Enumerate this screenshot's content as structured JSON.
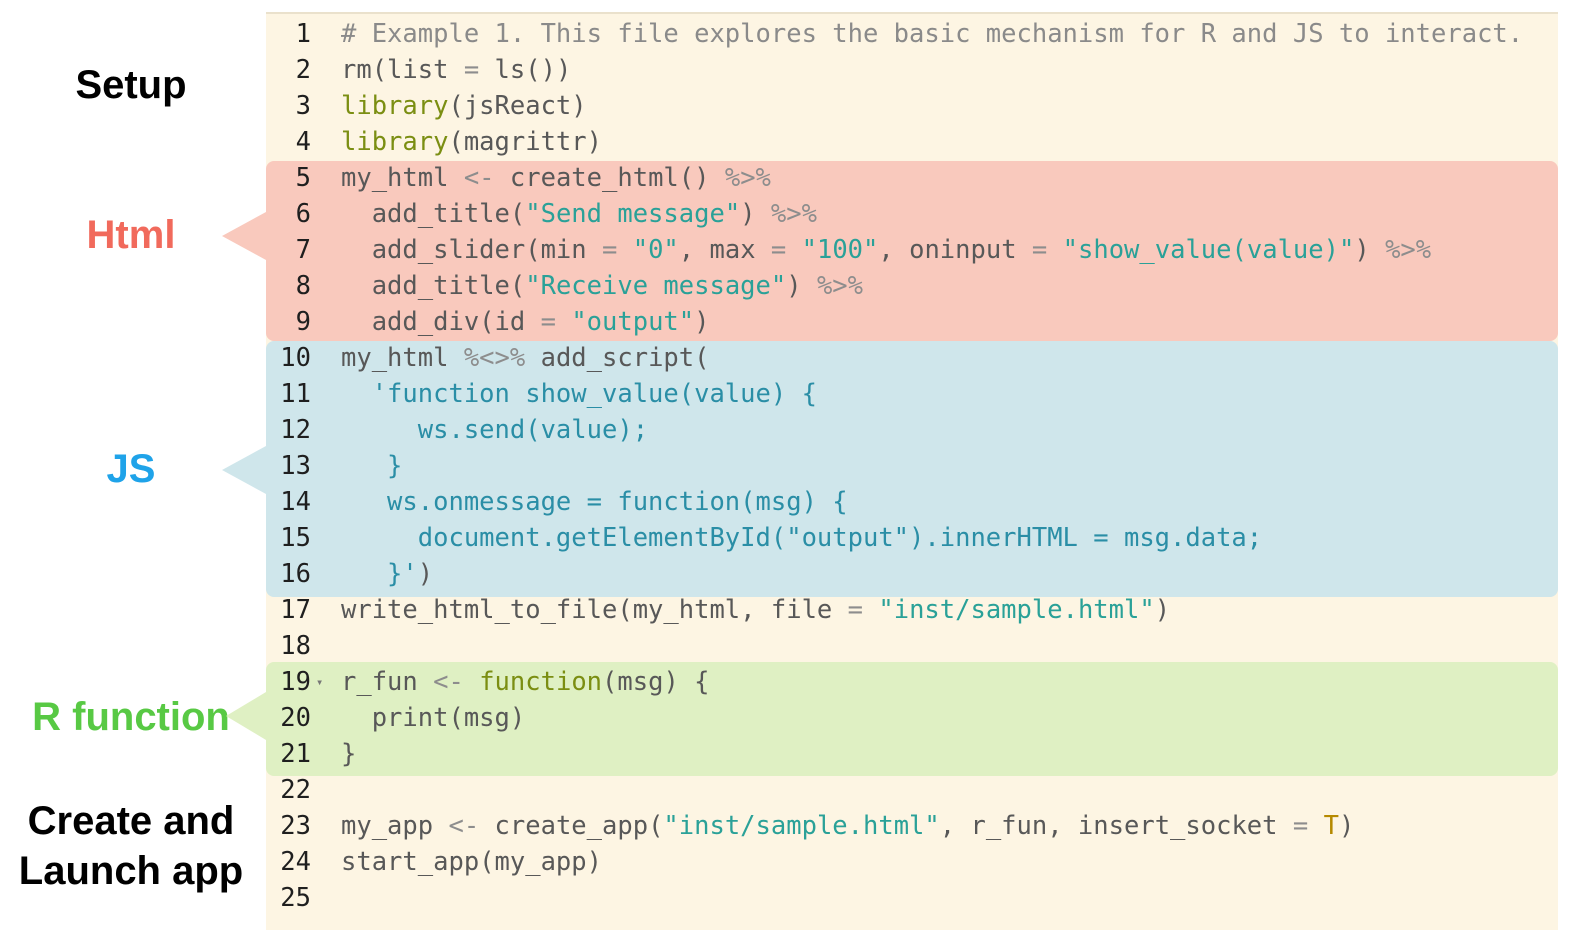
{
  "sections": {
    "setup": "Setup",
    "html": "Html",
    "js": "JS",
    "r_function": "R function",
    "launch_line1": "Create and",
    "launch_line2": "Launch app"
  },
  "colors": {
    "html_block": "#f9c9bd",
    "js_block": "#cfe6eb",
    "r_function_block": "#dff0c3",
    "editor_bg": "#fdf5e3"
  },
  "fold_icon": "triangle-down-icon",
  "code_lines": [
    {
      "n": "1",
      "tokens": [
        [
          "c-comment",
          "# Example 1. This file explores the basic mechanism for R and JS to interact."
        ]
      ]
    },
    {
      "n": "2",
      "tokens": [
        [
          "c-plain",
          "rm(list "
        ],
        [
          "c-op",
          "="
        ],
        [
          "c-plain",
          " ls())"
        ]
      ]
    },
    {
      "n": "3",
      "tokens": [
        [
          "c-fn",
          "library"
        ],
        [
          "c-plain",
          "(jsReact)"
        ]
      ]
    },
    {
      "n": "4",
      "tokens": [
        [
          "c-fn",
          "library"
        ],
        [
          "c-plain",
          "(magrittr)"
        ]
      ]
    },
    {
      "n": "5",
      "tokens": [
        [
          "c-plain",
          "my_html "
        ],
        [
          "c-op",
          "<-"
        ],
        [
          "c-plain",
          " create_html() "
        ],
        [
          "c-op",
          "%>%"
        ]
      ]
    },
    {
      "n": "6",
      "tokens": [
        [
          "c-plain",
          "  add_title("
        ],
        [
          "c-str",
          "\"Send message\""
        ],
        [
          "c-plain",
          ") "
        ],
        [
          "c-op",
          "%>%"
        ]
      ]
    },
    {
      "n": "7",
      "tokens": [
        [
          "c-plain",
          "  add_slider(min "
        ],
        [
          "c-op",
          "="
        ],
        [
          "c-plain",
          " "
        ],
        [
          "c-str",
          "\"0\""
        ],
        [
          "c-plain",
          ", max "
        ],
        [
          "c-op",
          "="
        ],
        [
          "c-plain",
          " "
        ],
        [
          "c-str",
          "\"100\""
        ],
        [
          "c-plain",
          ", oninput "
        ],
        [
          "c-op",
          "="
        ],
        [
          "c-plain",
          " "
        ],
        [
          "c-str",
          "\"show_value(value)\""
        ],
        [
          "c-plain",
          ") "
        ],
        [
          "c-op",
          "%>%"
        ]
      ]
    },
    {
      "n": "8",
      "tokens": [
        [
          "c-plain",
          "  add_title("
        ],
        [
          "c-str",
          "\"Receive message\""
        ],
        [
          "c-plain",
          ") "
        ],
        [
          "c-op",
          "%>%"
        ]
      ]
    },
    {
      "n": "9",
      "tokens": [
        [
          "c-plain",
          "  add_div(id "
        ],
        [
          "c-op",
          "="
        ],
        [
          "c-plain",
          " "
        ],
        [
          "c-str",
          "\"output\""
        ],
        [
          "c-plain",
          ")"
        ]
      ]
    },
    {
      "n": "10",
      "tokens": [
        [
          "c-plain",
          "my_html "
        ],
        [
          "c-op",
          "%<>%"
        ],
        [
          "c-plain",
          " add_script("
        ]
      ]
    },
    {
      "n": "11",
      "tokens": [
        [
          "c-js",
          "  'function show_value(value) {"
        ]
      ]
    },
    {
      "n": "12",
      "tokens": [
        [
          "c-js",
          "     ws.send(value);"
        ]
      ]
    },
    {
      "n": "13",
      "tokens": [
        [
          "c-js",
          "   }"
        ]
      ]
    },
    {
      "n": "14",
      "tokens": [
        [
          "c-js",
          "   ws.onmessage = function(msg) {"
        ]
      ]
    },
    {
      "n": "15",
      "tokens": [
        [
          "c-js",
          "     document.getElementById(\"output\").innerHTML = msg.data;"
        ]
      ]
    },
    {
      "n": "16",
      "tokens": [
        [
          "c-js",
          "   }'"
        ],
        [
          "c-plain",
          ")"
        ]
      ]
    },
    {
      "n": "17",
      "tokens": [
        [
          "c-plain",
          "write_html_to_file(my_html, file "
        ],
        [
          "c-op",
          "="
        ],
        [
          "c-plain",
          " "
        ],
        [
          "c-str",
          "\"inst/sample.html\""
        ],
        [
          "c-plain",
          ")"
        ]
      ]
    },
    {
      "n": "18",
      "tokens": []
    },
    {
      "n": "19",
      "fold": true,
      "tokens": [
        [
          "c-plain",
          "r_fun "
        ],
        [
          "c-op",
          "<-"
        ],
        [
          "c-plain",
          " "
        ],
        [
          "c-fn",
          "function"
        ],
        [
          "c-plain",
          "(msg) {"
        ]
      ]
    },
    {
      "n": "20",
      "tokens": [
        [
          "c-plain",
          "  print(msg)"
        ]
      ]
    },
    {
      "n": "21",
      "tokens": [
        [
          "c-plain",
          "}"
        ]
      ]
    },
    {
      "n": "22",
      "tokens": []
    },
    {
      "n": "23",
      "tokens": [
        [
          "c-plain",
          "my_app "
        ],
        [
          "c-op",
          "<-"
        ],
        [
          "c-plain",
          " create_app("
        ],
        [
          "c-str",
          "\"inst/sample.html\""
        ],
        [
          "c-plain",
          ", r_fun, insert_socket "
        ],
        [
          "c-op",
          "="
        ],
        [
          "c-plain",
          " "
        ],
        [
          "c-const",
          "T"
        ],
        [
          "c-plain",
          ")"
        ]
      ]
    },
    {
      "n": "24",
      "tokens": [
        [
          "c-plain",
          "start_app(my_app)"
        ]
      ]
    },
    {
      "n": "25",
      "tokens": []
    }
  ]
}
